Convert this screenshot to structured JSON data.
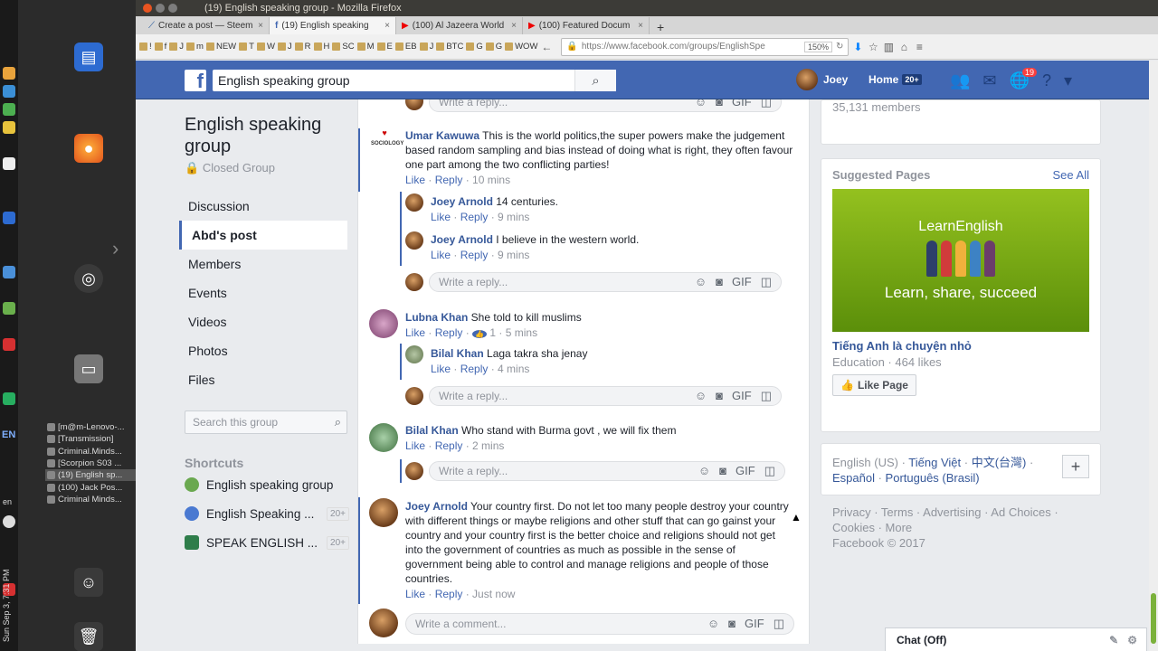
{
  "window": {
    "title": "(19) English speaking group - Mozilla Firefox"
  },
  "tabs": [
    {
      "label": "Create a post — Steem"
    },
    {
      "label": "(19) English speaking"
    },
    {
      "label": "(100) Al Jazeera World"
    },
    {
      "label": "(100) Featured Docum"
    }
  ],
  "bookmarks": [
    "!",
    "f",
    "J",
    "m",
    "NEW",
    "T",
    "W",
    "J",
    "R",
    "H",
    "SC",
    "M",
    "E",
    "EB",
    "J",
    "BTC",
    "G",
    "G",
    "WOW"
  ],
  "url": {
    "text": "https://www.facebook.com/groups/EnglishSpe",
    "zoom": "150%"
  },
  "fb": {
    "search": "English speaking group",
    "user": "Joey",
    "home": "Home",
    "home_count": "20+",
    "notif_count": "19"
  },
  "group": {
    "title": "English speaking group",
    "privacy": "Closed Group",
    "nav": [
      "Discussion",
      "Abd's post",
      "Members",
      "Events",
      "Videos",
      "Photos",
      "Files"
    ],
    "search_placeholder": "Search this group",
    "shortcuts_title": "Shortcuts",
    "shortcuts": [
      {
        "label": "English speaking group",
        "count": ""
      },
      {
        "label": "English Speaking ...",
        "count": "20+"
      },
      {
        "label": "SPEAK ENGLISH ...",
        "count": "20+"
      }
    ]
  },
  "feed": {
    "reply_placeholder": "Write a reply...",
    "comment_placeholder": "Write a comment...",
    "like": "Like",
    "reply": "Reply",
    "c1": {
      "name": "Umar Kawuwa",
      "text": "This is the world politics,the super powers make the judgement based random sampling and bias instead of doing what is right, they often favour one part among the two conflicting parties!",
      "time": "10 mins"
    },
    "r1": {
      "name": "Joey Arnold",
      "text": "14 centuries.",
      "time": "9 mins"
    },
    "r2": {
      "name": "Joey Arnold",
      "text": "I believe in the western world.",
      "time": "9 mins"
    },
    "c2": {
      "name": "Lubna Khan",
      "text": "She told to kill muslims",
      "likes": "1",
      "time": "5 mins"
    },
    "r3": {
      "name": "Bilal Khan",
      "text": "Laga takra sha jenay",
      "time": "4 mins"
    },
    "c3": {
      "name": "Bilal Khan",
      "text": "Who stand with Burma govt , we will fix them",
      "time": "2 mins"
    },
    "c4": {
      "name": "Joey Arnold",
      "text": "Your country first. Do not let too many people destroy your country with different things or maybe religions and other stuff that can go gainst your country and your country first is the better choice and religions should not get into the government of countries as much as possible in the sense of government being able to control and manage religions and people of those countries.",
      "time": "Just now"
    }
  },
  "right": {
    "members": "35,131 members",
    "suggested_title": "Suggested Pages",
    "see_all": "See All",
    "banner_brand": "LearnEnglish",
    "banner_tag": "Learn, share, succeed",
    "page_name": "Tiếng Anh là chuyện nhỏ",
    "page_meta": "Education · 464 likes",
    "like_page": "Like Page",
    "lang_current": "English (US)",
    "langs": [
      "Tiếng Việt",
      "中文(台灣)",
      "Español",
      "Português (Brasil)"
    ],
    "footer_links": "Privacy · Terms · Advertising · Ad Choices · Cookies · More",
    "copyright": "Facebook © 2017",
    "chat": "Chat (Off)"
  },
  "taskbar": {
    "items": [
      "[m@m-Lenovo-...",
      "[Transmission]",
      "Criminal.Minds...",
      "[Scorpion S03 ...",
      "(19) English sp...",
      "(100) Jack Pos...",
      "Criminal Minds..."
    ],
    "lang": "EN",
    "lang2": "en",
    "clock": "Sun Sep 3, 7:31 PM"
  }
}
